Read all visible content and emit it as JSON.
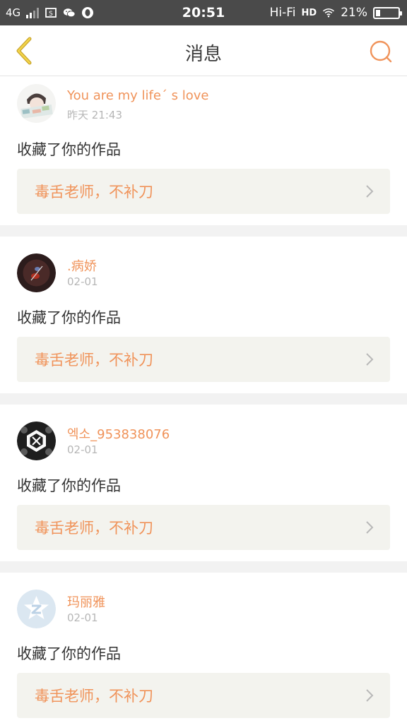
{
  "status_bar": {
    "network": "4G",
    "time": "20:51",
    "hifi": "Hi-Fi",
    "hd": "HD",
    "battery_percent": "21%",
    "battery_level": 0.21,
    "icons": [
      "signal-icon",
      "screenshot-icon",
      "wechat-icon",
      "qq-icon",
      "wifi-icon",
      "battery-icon"
    ]
  },
  "nav": {
    "title": "消息",
    "back_icon": "chevron-left-icon",
    "search_icon": "search-icon",
    "accent_color": "#f0935a"
  },
  "messages": [
    {
      "user": "You are my life´ s love",
      "time": "昨天 21:43",
      "action": "收藏了你的作品",
      "work": "毒舌老师，不补刀",
      "avatar": "anime-character-avatar"
    },
    {
      "user": ".病娇",
      "time": "02-01",
      "action": "收藏了你的作品",
      "work": "毒舌老师，不补刀",
      "avatar": "dark-red-avatar"
    },
    {
      "user": "엑소_953838076",
      "time": "02-01",
      "action": "收藏了你的作品",
      "work": "毒舌老师，不补刀",
      "avatar": "exo-logo-avatar"
    },
    {
      "user": "玛丽雅",
      "time": "02-01",
      "action": "收藏了你的作品",
      "work": "毒舌老师，不补刀",
      "avatar": "default-qzone-avatar"
    }
  ]
}
